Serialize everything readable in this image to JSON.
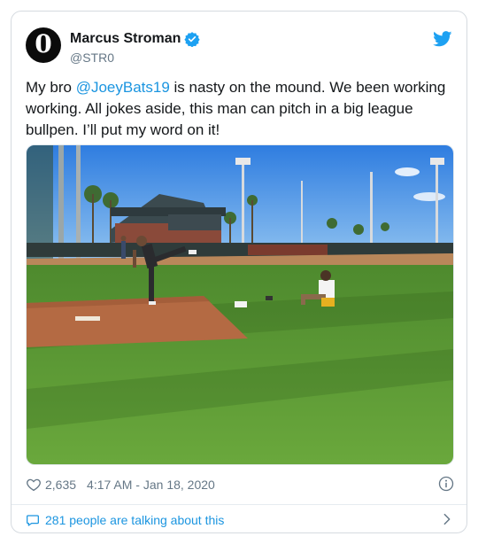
{
  "author": {
    "display_name": "Marcus Stroman",
    "handle": "@STR0",
    "avatar_glyph": "0",
    "verified": true
  },
  "tweet": {
    "text_before": "My bro ",
    "mention": "@JoeyBats19",
    "text_after": " is nasty on the mound. We been working working. All jokes aside, this man can pitch in a big league bullpen. I’ll put my word on it!"
  },
  "stats": {
    "likes": "2,635",
    "timestamp": "4:17 AM - Jan 18, 2020"
  },
  "footer": {
    "talking": "281 people are talking about this"
  },
  "icons": {
    "brand": "twitter-bird-icon",
    "verified": "verified-badge-icon",
    "like": "heart-icon",
    "info": "info-icon",
    "reply": "speech-bubble-icon",
    "more": "chevron-right-icon"
  },
  "colors": {
    "accent": "#1da1f2",
    "link": "#1b95e0",
    "secondary_text": "#657786",
    "border": "#d6dbe0"
  }
}
